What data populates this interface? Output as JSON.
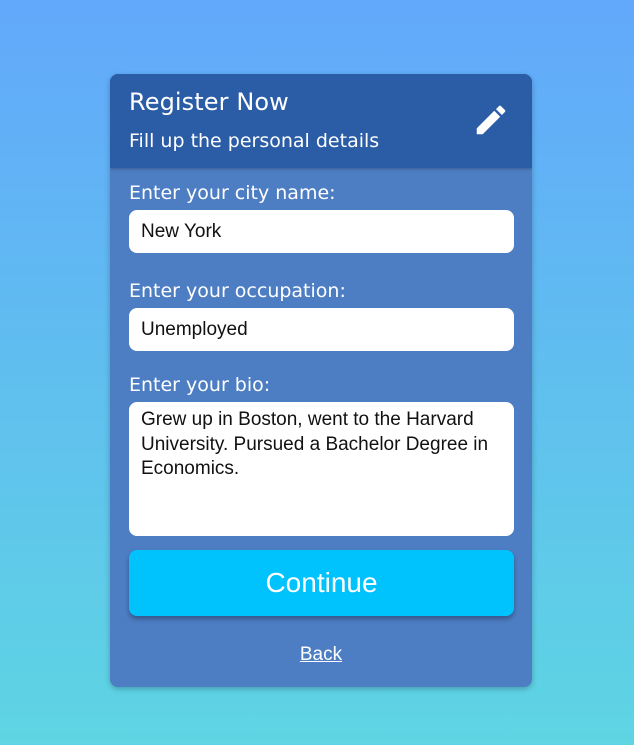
{
  "header": {
    "title": "Register Now",
    "subtitle": "Fill up the personal details",
    "icon": "pencil-icon"
  },
  "form": {
    "city": {
      "label": "Enter your city name:",
      "value": "New York"
    },
    "occupation": {
      "label": "Enter your occupation:",
      "value": "Unemployed"
    },
    "bio": {
      "label": "Enter your bio:",
      "value": "Grew up in Boston, went to the Harvard University. Pursued a Bachelor Degree in Economics."
    }
  },
  "actions": {
    "continue_label": "Continue",
    "back_label": "Back"
  },
  "colors": {
    "background_top": "#62a8fb",
    "background_bottom": "#5ed5e3",
    "card": "#4d7dc3",
    "header": "#2b5ca6",
    "button": "#00c3fe"
  }
}
